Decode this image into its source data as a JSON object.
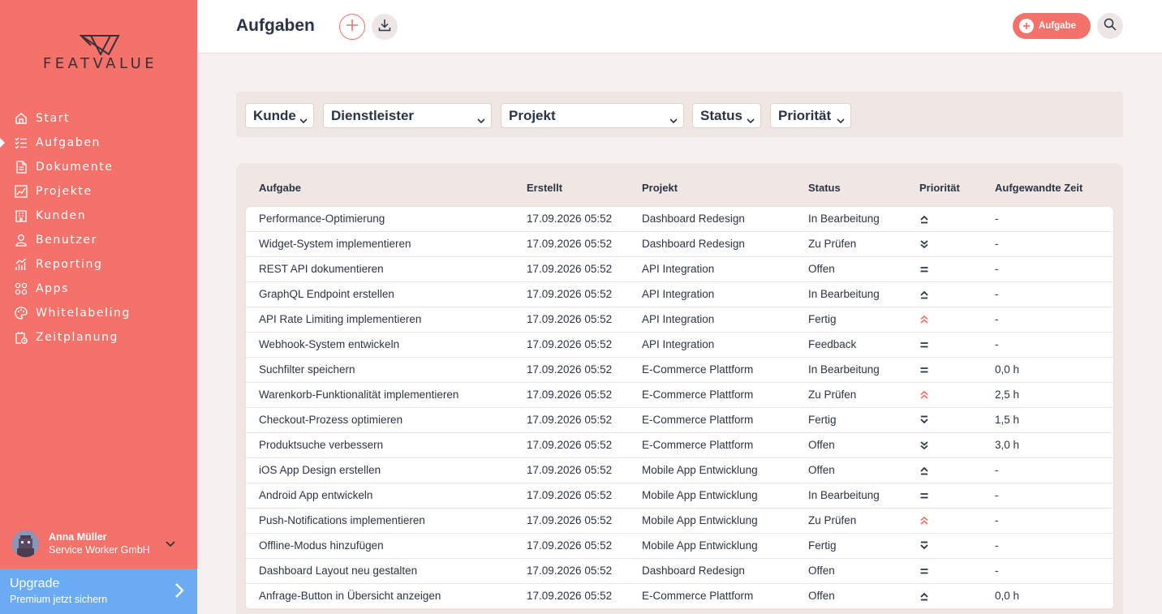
{
  "brand": {
    "name": "FEATVALUE"
  },
  "nav": [
    {
      "label": "Start",
      "icon": "home-icon",
      "active": false
    },
    {
      "label": "Aufgaben",
      "icon": "checklist-icon",
      "active": true
    },
    {
      "label": "Dokumente",
      "icon": "document-icon",
      "active": false
    },
    {
      "label": "Projekte",
      "icon": "chart-icon",
      "active": false
    },
    {
      "label": "Kunden",
      "icon": "building-icon",
      "active": false
    },
    {
      "label": "Benutzer",
      "icon": "user-icon",
      "active": false
    },
    {
      "label": "Reporting",
      "icon": "reporting-icon",
      "active": false
    },
    {
      "label": "Apps",
      "icon": "apps-icon",
      "active": false
    },
    {
      "label": "Whitelabeling",
      "icon": "palette-icon",
      "active": false
    },
    {
      "label": "Zeitplanung",
      "icon": "schedule-icon",
      "active": false
    }
  ],
  "user": {
    "name": "Anna Müller",
    "company": "Service Worker GmbH"
  },
  "upgrade": {
    "title": "Upgrade",
    "subtitle": "Premium jetzt sichern"
  },
  "header": {
    "title": "Aufgaben",
    "new_button": "Aufgabe"
  },
  "filters": [
    {
      "label": "Kunde"
    },
    {
      "label": "Dienstleister"
    },
    {
      "label": "Projekt"
    },
    {
      "label": "Status"
    },
    {
      "label": "Priorität"
    }
  ],
  "table": {
    "columns": [
      "Aufgabe",
      "Erstellt",
      "Projekt",
      "Status",
      "Priorität",
      "Aufgewandte Zeit"
    ],
    "rows": [
      {
        "task": "Performance-Optimierung",
        "created": "17.09.2026 05:52",
        "project": "Dashboard Redesign",
        "status": "In Bearbeitung",
        "priority": "high",
        "time": "-"
      },
      {
        "task": "Widget-System implementieren",
        "created": "17.09.2026 05:52",
        "project": "Dashboard Redesign",
        "status": "Zu Prüfen",
        "priority": "lowest",
        "time": "-"
      },
      {
        "task": "REST API dokumentieren",
        "created": "17.09.2026 05:52",
        "project": "API Integration",
        "status": "Offen",
        "priority": "medium",
        "time": "-"
      },
      {
        "task": "GraphQL Endpoint erstellen",
        "created": "17.09.2026 05:52",
        "project": "API Integration",
        "status": "In Bearbeitung",
        "priority": "high",
        "time": "-"
      },
      {
        "task": "API Rate Limiting implementieren",
        "created": "17.09.2026 05:52",
        "project": "API Integration",
        "status": "Fertig",
        "priority": "highest",
        "time": "-"
      },
      {
        "task": "Webhook-System entwickeln",
        "created": "17.09.2026 05:52",
        "project": "API Integration",
        "status": "Feedback",
        "priority": "medium",
        "time": "-"
      },
      {
        "task": "Suchfilter speichern",
        "created": "17.09.2026 05:52",
        "project": "E-Commerce Plattform",
        "status": "In Bearbeitung",
        "priority": "medium",
        "time": "0,0 h"
      },
      {
        "task": "Warenkorb-Funktionalität implementieren",
        "created": "17.09.2026 05:52",
        "project": "E-Commerce Plattform",
        "status": "Zu Prüfen",
        "priority": "highest",
        "time": "2,5 h"
      },
      {
        "task": "Checkout-Prozess optimieren",
        "created": "17.09.2026 05:52",
        "project": "E-Commerce Plattform",
        "status": "Fertig",
        "priority": "low",
        "time": "1,5 h"
      },
      {
        "task": "Produktsuche verbessern",
        "created": "17.09.2026 05:52",
        "project": "E-Commerce Plattform",
        "status": "Offen",
        "priority": "lowest",
        "time": "3,0 h"
      },
      {
        "task": "iOS App Design erstellen",
        "created": "17.09.2026 05:52",
        "project": "Mobile App Entwicklung",
        "status": "Offen",
        "priority": "high",
        "time": "-"
      },
      {
        "task": "Android App entwickeln",
        "created": "17.09.2026 05:52",
        "project": "Mobile App Entwicklung",
        "status": "In Bearbeitung",
        "priority": "medium",
        "time": "-"
      },
      {
        "task": "Push-Notifications implementieren",
        "created": "17.09.2026 05:52",
        "project": "Mobile App Entwicklung",
        "status": "Zu Prüfen",
        "priority": "highest",
        "time": "-"
      },
      {
        "task": "Offline-Modus hinzufügen",
        "created": "17.09.2026 05:52",
        "project": "Mobile App Entwicklung",
        "status": "Fertig",
        "priority": "low",
        "time": "-"
      },
      {
        "task": "Dashboard Layout neu gestalten",
        "created": "17.09.2026 05:52",
        "project": "Dashboard Redesign",
        "status": "Offen",
        "priority": "medium",
        "time": "-"
      },
      {
        "task": "Anfrage-Button in Übersicht anzeigen",
        "created": "17.09.2026 05:52",
        "project": "E-Commerce Plattform",
        "status": "Offen",
        "priority": "high",
        "time": "0,0 h"
      }
    ]
  },
  "colors": {
    "accent": "#f4726a",
    "upgrade": "#6aabf1",
    "text": "#2b3445"
  }
}
